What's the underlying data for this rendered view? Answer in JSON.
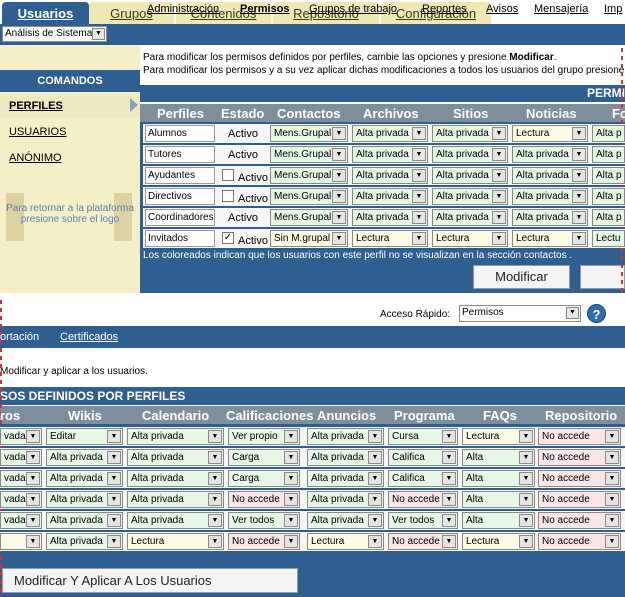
{
  "tabs": [
    {
      "label": "Usuarios",
      "active": true
    },
    {
      "label": "Grupos"
    },
    {
      "label": "Contenidos"
    },
    {
      "label": "Repositorio"
    },
    {
      "label": "Configuración"
    }
  ],
  "system_select": "Análisis de Sistema",
  "subnav": [
    "Administración",
    "Permisos",
    "Grupos de trabajo",
    "Reportes",
    "Avisos",
    "Mensajería",
    "Imp"
  ],
  "lower_subnav": [
    "ortación",
    "Certificados"
  ],
  "sidebar": {
    "title": "COMANDOS",
    "items": [
      "PERFILES",
      "USUARIOS",
      "ANÓNIMO"
    ],
    "return_text": "Para retornar a la plataforma presione sobre el logo"
  },
  "intro": {
    "line1_a": "Para modificar los permisos definidos por perfiles, cambie las opciones y presione ",
    "line1_b": "Modificar",
    "line2": "Para modificar los permisos y a su vez aplicar dichas modificaciones a todos los usuarios del grupo presione",
    "line2_cont": "Modificar y aplicar a los usuarios."
  },
  "title_right": "PERMI",
  "title_lower": "SOS DEFINIDOS POR PERFILES",
  "headers_top": [
    "Perfiles",
    "Estado",
    "Contactos",
    "Archivos",
    "Sitios",
    "Noticias",
    "Fo"
  ],
  "headers_low": [
    "ros",
    "Wikis",
    "Calendario",
    "Calificaciones",
    "Anuncios",
    "Programa",
    "FAQs",
    "Repositorio"
  ],
  "rows": [
    {
      "name": "Alumnos",
      "estado": "Activo",
      "check": null,
      "top": [
        "Mens.Grupal",
        "Alta privada",
        "Alta privada",
        "Lectura",
        "Alta p"
      ],
      "low": [
        "vada",
        "Editar",
        "Alta privada",
        "Ver propio",
        "Alta privada",
        "Cursa",
        "Lectura",
        "No accede"
      ]
    },
    {
      "name": "Tutores",
      "estado": "Activo",
      "check": null,
      "top": [
        "Mens.Grupal",
        "Alta privada",
        "Alta privada",
        "Alta privada",
        "Alta p"
      ],
      "low": [
        "vada",
        "Alta privada",
        "Alta privada",
        "Carga",
        "Alta privada",
        "Califica",
        "Alta",
        "No accede"
      ]
    },
    {
      "name": "Ayudantes",
      "estado": "Activo",
      "check": false,
      "top": [
        "Mens.Grupal",
        "Alta privada",
        "Alta privada",
        "Alta privada",
        "Alta p"
      ],
      "low": [
        "vada",
        "Alta privada",
        "Alta privada",
        "Carga",
        "Alta privada",
        "Califica",
        "Alta",
        "No accede"
      ]
    },
    {
      "name": "Directivos",
      "estado": "Activo",
      "check": false,
      "top": [
        "Mens.Grupal",
        "Alta privada",
        "Alta privada",
        "Alta privada",
        "Alta p"
      ],
      "low": [
        "vada",
        "Alta privada",
        "Alta privada",
        "No accede",
        "Alta privada",
        "No accede",
        "Alta",
        "No accede"
      ]
    },
    {
      "name": "Coordinadores",
      "estado": "Activo",
      "check": null,
      "top": [
        "Mens.Grupal",
        "Alta privada",
        "Alta privada",
        "Alta privada",
        "Alta p"
      ],
      "low": [
        "vada",
        "Alta privada",
        "Alta privada",
        "Ver todos",
        "Alta privada",
        "Ver todos",
        "Alta",
        "No accede"
      ]
    },
    {
      "name": "Invitados",
      "estado": "Activo",
      "check": true,
      "top": [
        "Sin M.grupal",
        "Lectura",
        "Lectura",
        "Lectura",
        "Lectu"
      ],
      "low": [
        "",
        "Alta privada",
        "Lectura",
        "No accede",
        "Lectura",
        "No accede",
        "Lectura",
        "No accede"
      ]
    }
  ],
  "note": "Los coloreados indican que los usuarios con este perfil no se visualizan en la sección contactos .",
  "buttons": {
    "modificar": "Modificar",
    "modificar_aplicar": "Modificar Y Aplicar A Los Usuarios"
  },
  "acceso": {
    "label": "Acceso Rápido:",
    "value": "Permisos"
  },
  "colors": {
    "blue": "#2f5f91",
    "tab": "#f1e7b5",
    "header": "#7f8e9d",
    "green": "#e6f7e6",
    "cream": "#fdfbe6",
    "pink": "#fbe6e6"
  }
}
